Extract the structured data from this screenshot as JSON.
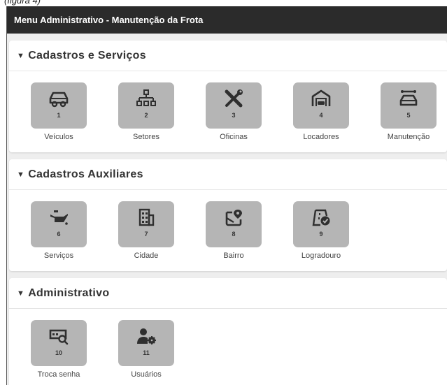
{
  "caption": "(figura 4)",
  "header": {
    "title": "Menu Administrativo - Manutenção da Frota"
  },
  "sections": [
    {
      "title": "Cadastros e Serviços",
      "items": [
        {
          "num": "1",
          "label": "Veículos",
          "icon": "car-icon"
        },
        {
          "num": "2",
          "label": "Setores",
          "icon": "org-chart-icon"
        },
        {
          "num": "3",
          "label": "Oficinas",
          "icon": "tools-icon"
        },
        {
          "num": "4",
          "label": "Locadores",
          "icon": "garage-icon"
        },
        {
          "num": "5",
          "label": "Manutenção",
          "icon": "car-service-icon"
        }
      ]
    },
    {
      "title": "Cadastros Auxiliares",
      "items": [
        {
          "num": "6",
          "label": "Serviços",
          "icon": "oil-can-icon"
        },
        {
          "num": "7",
          "label": "Cidade",
          "icon": "building-icon"
        },
        {
          "num": "8",
          "label": "Bairro",
          "icon": "map-pin-icon"
        },
        {
          "num": "9",
          "label": "Logradouro",
          "icon": "road-check-icon"
        }
      ]
    },
    {
      "title": "Administrativo",
      "items": [
        {
          "num": "10",
          "label": "Troca senha",
          "icon": "password-search-icon"
        },
        {
          "num": "11",
          "label": "Usuários",
          "icon": "user-gear-icon"
        }
      ]
    }
  ],
  "colors": {
    "topbar": "#2b2b2b",
    "tile": "#b5b5b5",
    "icon": "#2f2f2f"
  }
}
